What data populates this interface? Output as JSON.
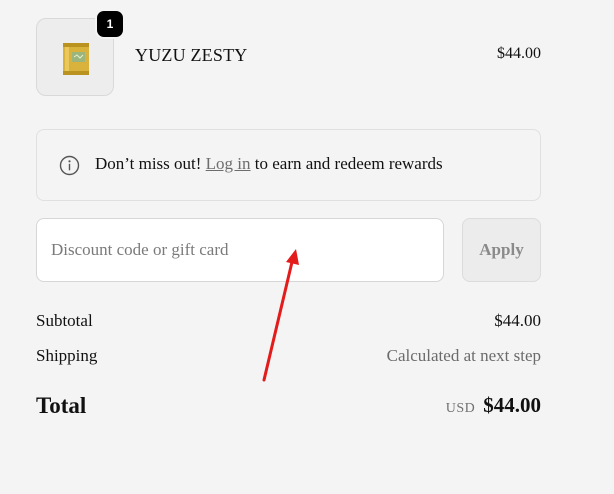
{
  "cart": {
    "item": {
      "name": "YUZU ZESTY",
      "price": "$44.00",
      "quantity": "1",
      "thumbnail_icon": "yuzu-can-icon"
    }
  },
  "rewards": {
    "icon": "info-icon",
    "prefix": "Don’t miss out! ",
    "link_label": "Log in",
    "suffix": " to earn and redeem rewards"
  },
  "discount": {
    "placeholder": "Discount code or gift card",
    "value": "",
    "apply_label": "Apply"
  },
  "summary": {
    "subtotal_label": "Subtotal",
    "subtotal_value": "$44.00",
    "shipping_label": "Shipping",
    "shipping_value": "Calculated at next step",
    "total_label": "Total",
    "currency": "USD",
    "total_value": "$44.00"
  },
  "annotation": {
    "arrow_color": "#e31b1b"
  }
}
